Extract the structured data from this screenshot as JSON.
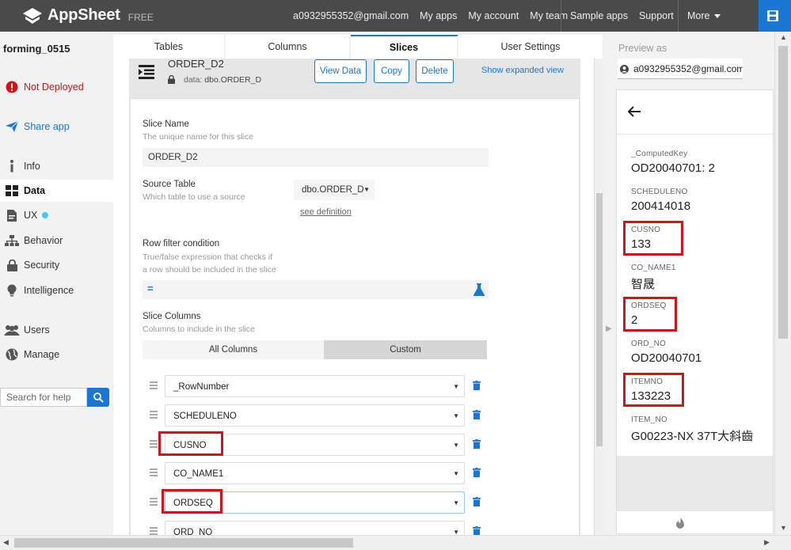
{
  "topbar": {
    "brand": "AppSheet",
    "plan": "FREE",
    "email": "a0932955352@gmail.com",
    "links": [
      "My apps",
      "My account",
      "My team"
    ],
    "sample_apps": "Sample apps",
    "support": "Support",
    "more": "More"
  },
  "sidebar": {
    "app_name": "forming_0515",
    "deploy_status": "Not Deployed",
    "share": "Share app",
    "items": [
      "Info",
      "Data",
      "UX",
      "Behavior",
      "Security",
      "Intelligence",
      "Users",
      "Manage"
    ],
    "active_item": "Data",
    "search_placeholder": "Search for help"
  },
  "tabs": [
    "Tables",
    "Columns",
    "Slices",
    "User Settings"
  ],
  "active_tab": "Slices",
  "slice": {
    "name": "ORDER_D2",
    "data_prefix": "data:",
    "data_source": "dbo.ORDER_D",
    "buttons": {
      "view": "View Data",
      "copy": "Copy",
      "delete": "Delete"
    },
    "expanded_link": "Show expanded view",
    "slice_name_label": "Slice Name",
    "slice_name_desc": "The unique name for this slice",
    "slice_name_value": "ORDER_D2",
    "source_table_label": "Source Table",
    "source_table_desc": "Which table to use a source",
    "source_table_value": "dbo.ORDER_D",
    "see_definition": "see definition",
    "row_filter_label": "Row filter condition",
    "row_filter_desc1": "True/false expression that checks if",
    "row_filter_desc2": "a row should be included in the slice",
    "row_filter_eq": "=",
    "slice_columns_label": "Slice Columns",
    "slice_columns_desc": "Columns to include in the slice",
    "all_columns": "All Columns",
    "custom": "Custom",
    "columns": [
      "_RowNumber",
      "SCHEDULENO",
      "CUSNO",
      "CO_NAME1",
      "ORDSEQ",
      "ORD_NO"
    ]
  },
  "preview": {
    "label": "Preview as",
    "user": "a0932955352@gmail.com",
    "fields": [
      {
        "label": "_ComputedKey",
        "value": "OD20040701: 2"
      },
      {
        "label": "SCHEDULENO",
        "value": "200414018"
      },
      {
        "label": "CUSNO",
        "value": "133"
      },
      {
        "label": "CO_NAME1",
        "value": "智晟"
      },
      {
        "label": "ORDSEQ",
        "value": "2"
      },
      {
        "label": "ORD_NO",
        "value": "OD20040701"
      },
      {
        "label": "ITEMNO",
        "value": "133223"
      },
      {
        "label": "ITEM_NO",
        "value": "G00223-NX 37T大斜齒"
      }
    ]
  },
  "colors": {
    "accent": "#1976d2",
    "highlight": "#d0141a",
    "topbar": "#4a4a4a"
  }
}
